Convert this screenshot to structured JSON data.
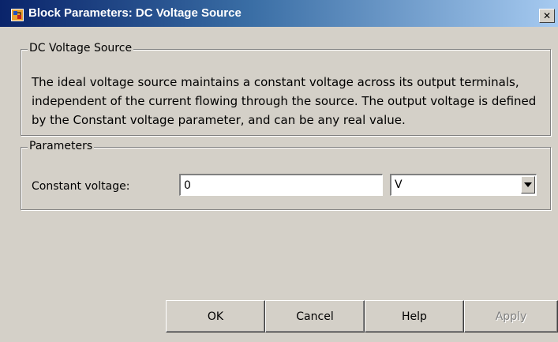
{
  "window": {
    "title": "Block Parameters: DC Voltage Source",
    "icon": "simulink-block-icon",
    "close_glyph": "✕"
  },
  "description_group": {
    "legend": "DC Voltage Source",
    "text": "The ideal voltage source maintains a constant voltage across its output terminals, independent of the current flowing through the source. The output voltage is defined by the Constant voltage parameter, and can be any real value."
  },
  "parameters_group": {
    "legend": "Parameters",
    "constant_voltage": {
      "label": "Constant voltage:",
      "value": "0",
      "unit": "V"
    }
  },
  "buttons": {
    "ok": "OK",
    "cancel": "Cancel",
    "help": "Help",
    "apply": "Apply"
  },
  "colors": {
    "title_gradient_start": "#0a246a",
    "title_gradient_end": "#a6caf0",
    "face": "#d4d0c8"
  }
}
